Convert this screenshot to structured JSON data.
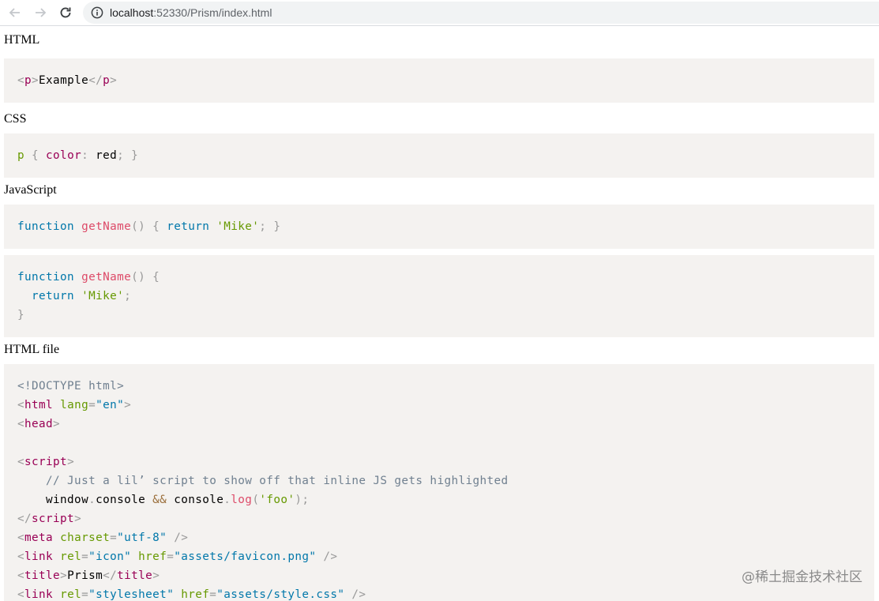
{
  "browser": {
    "url_host": "localhost",
    "url_rest": ":52330/Prism/index.html",
    "icons": [
      "back-icon",
      "forward-icon",
      "reload-icon",
      "info-icon"
    ]
  },
  "sections": {
    "html": {
      "title": "HTML"
    },
    "css": {
      "title": "CSS"
    },
    "js": {
      "title": "JavaScript"
    },
    "htmlfile": {
      "title": "HTML file"
    }
  },
  "code": {
    "html_example": {
      "t1": "<",
      "t2": "p",
      "t3": ">",
      "t4": "Example",
      "t5": "</",
      "t6": "p",
      "t7": ">"
    },
    "css_example": {
      "selector": "p",
      "open": " { ",
      "prop": "color",
      "colon": ":",
      "value": " red",
      "semi": ";",
      "close": " }"
    },
    "js_inline": {
      "kw": "function",
      "name": "getName",
      "paren": "()",
      "brace": " { ",
      "ret": "return",
      "str": "'Mike'",
      "semi": ";",
      "close": " }"
    },
    "js_block": {
      "kw": "function",
      "name": "getName",
      "paren": "()",
      "brace": " {",
      "ret": "return",
      "str": "'Mike'",
      "semi": ";",
      "close": "}"
    },
    "html_file": {
      "doctype": "<!DOCTYPE html>",
      "html_tag": "html",
      "lang_attr": "lang",
      "lang_val": "\"en\"",
      "head_tag": "head",
      "script_tag": "script",
      "comment": "// Just a lil’ script to show off that inline JS gets highlighted",
      "window": "window",
      "dot": ".",
      "console": "console",
      "and": "&&",
      "log": "log",
      "foo": "'foo'",
      "meta_tag": "meta",
      "charset_attr": "charset",
      "charset_val": "\"utf-8\"",
      "link_tag": "link",
      "rel_attr": "rel",
      "icon_val": "\"icon\"",
      "href_attr": "href",
      "favicon_val": "\"assets/favicon.png\"",
      "title_tag": "title",
      "title_text": "Prism",
      "stylesheet_val": "\"stylesheet\"",
      "style_val": "\"assets/style.css\""
    }
  },
  "watermark": "@稀土掘金技术社区"
}
